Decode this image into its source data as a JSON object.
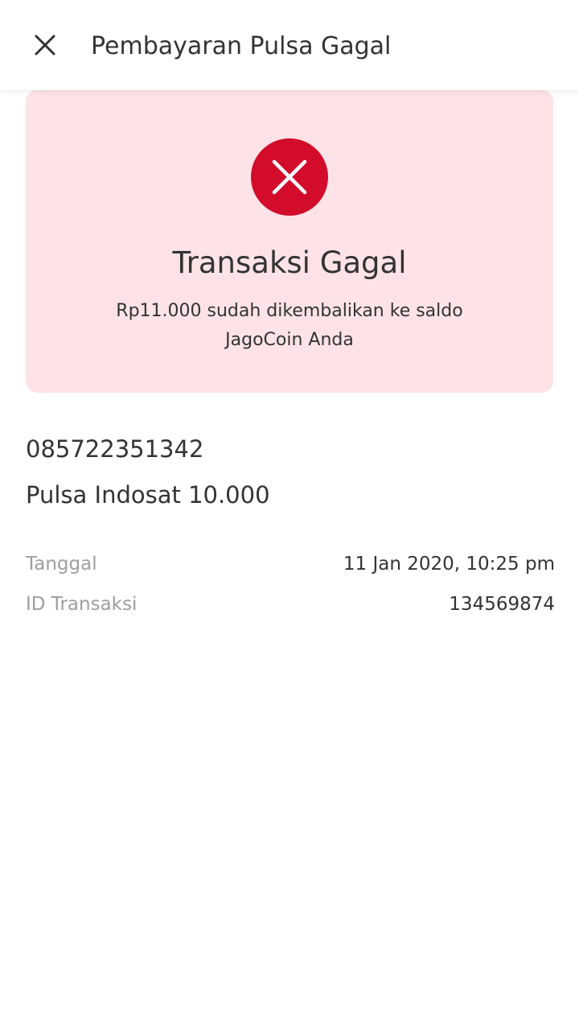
{
  "header": {
    "title": "Pembayaran Pulsa Gagal",
    "close_icon": "close-icon"
  },
  "status": {
    "icon": "error-x-icon",
    "icon_color": "#d20c2a",
    "card_color": "#fde3e7",
    "title": "Transaksi Gagal",
    "message": "Rp11.000 sudah dikembalikan ke saldo JagoCoin Anda"
  },
  "transaction": {
    "phone_number": "085722351342",
    "product": "Pulsa Indosat 10.000",
    "details": [
      {
        "label": "Tanggal",
        "value": "11 Jan 2020, 10:25 pm"
      },
      {
        "label": "ID Transaksi",
        "value": "134569874"
      }
    ]
  }
}
